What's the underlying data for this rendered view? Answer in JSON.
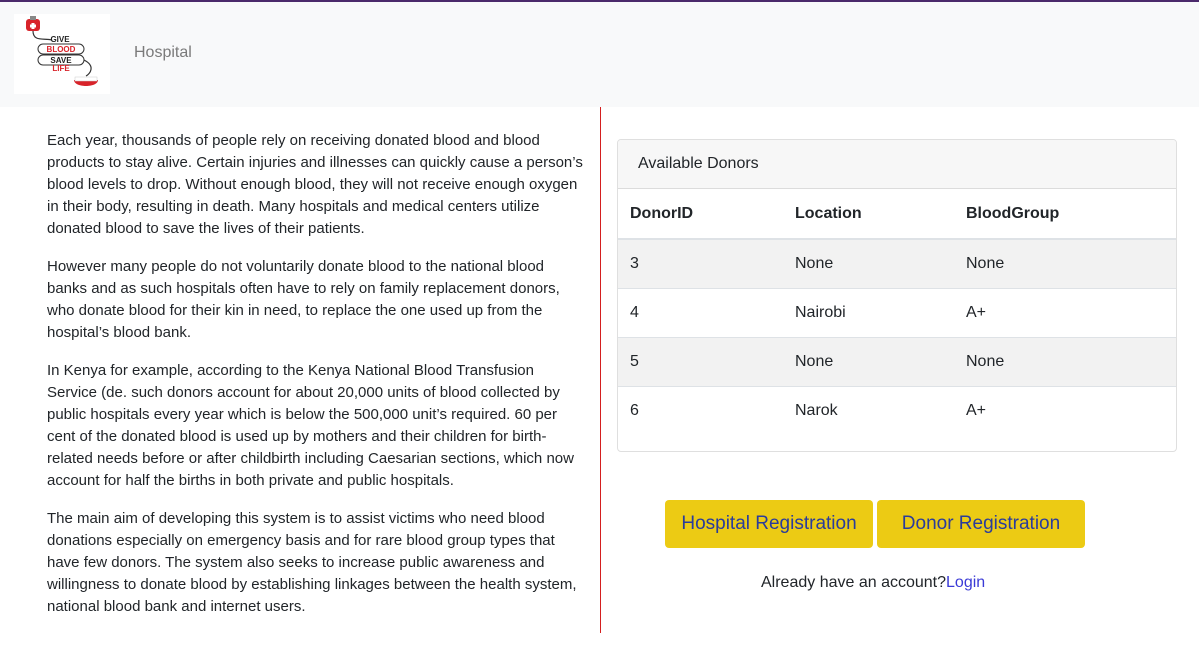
{
  "header": {
    "logo_alt": "GIVE BLOOD SAVE LIFE",
    "brand": "Hospital"
  },
  "intro": {
    "paragraphs": [
      "Each year, thousands of people rely on receiving donated blood and blood products to stay alive. Certain injuries and illnesses can quickly cause a person’s blood levels to drop. Without enough blood, they will not receive enough oxygen in their body, resulting in death. Many hospitals and medical centers utilize donated blood to save the lives of their patients.",
      "However many people do not voluntarily donate blood to the national blood banks and as such hospitals often have to rely on family replacement donors, who donate blood for their kin in need, to replace the one used up from the hospital’s blood bank.",
      "In Kenya for example, according to the Kenya National Blood Transfusion Service (de. such donors account for about 20,000 units of blood collected by public hospitals every year which is below the 500,000 unit’s required. 60 per cent of the donated blood is used up by mothers and their children for birth-related needs before or after childbirth including Caesarian sections, which now account for half the births in both private and public hospitals.",
      "The main aim of developing this system is to assist victims who need blood donations especially on emergency basis and for rare blood group types that have few donors. The system also seeks to increase public awareness and willingness to donate blood by establishing linkages between the health system, national blood bank and internet users."
    ]
  },
  "donors": {
    "title": "Available Donors",
    "columns": [
      "DonorID",
      "Location",
      "BloodGroup"
    ],
    "rows": [
      [
        "3",
        "None",
        "None"
      ],
      [
        "4",
        "Nairobi",
        "A+"
      ],
      [
        "5",
        "None",
        "None"
      ],
      [
        "6",
        "Narok",
        "A+"
      ]
    ]
  },
  "actions": {
    "hospital_registration": "Hospital Registration",
    "donor_registration": "Donor Registration",
    "login_prompt": "Already have an account?",
    "login_link": "Login"
  }
}
